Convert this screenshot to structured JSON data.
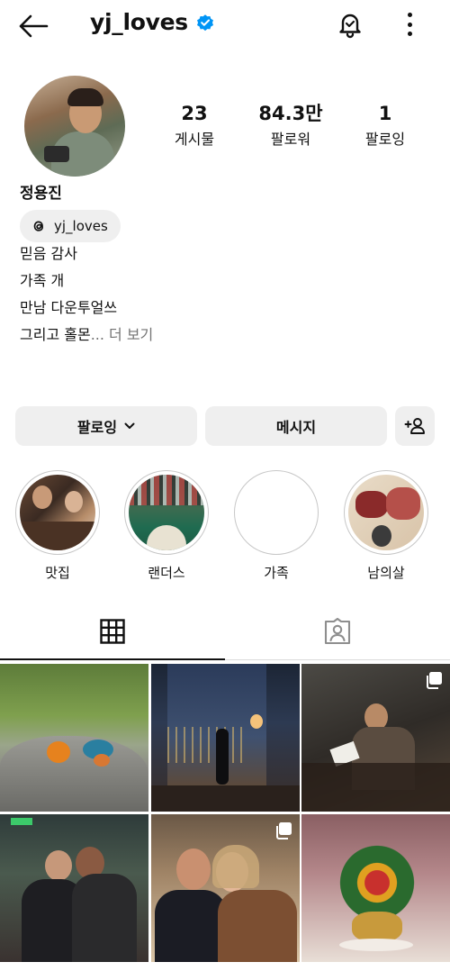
{
  "header": {
    "username": "yj_loves"
  },
  "profile": {
    "stats": [
      {
        "value": "23",
        "label": "게시물"
      },
      {
        "value": "84.3만",
        "label": "팔로워"
      },
      {
        "value": "1",
        "label": "팔로잉"
      }
    ],
    "name": "정용진",
    "threads_handle": "yj_loves",
    "bio_lines": [
      "믿음 감사",
      "가족 개",
      "만남 다운투얼쓰",
      "그리고 홀몬"
    ],
    "bio_more": "... 더 보기"
  },
  "actions": {
    "following_label": "팔로잉",
    "message_label": "메시지"
  },
  "highlights": [
    {
      "label": "맛집"
    },
    {
      "label": "랜더스"
    },
    {
      "label": "가족"
    },
    {
      "label": "남의살"
    }
  ],
  "tabs": [
    {
      "icon": "grid-icon"
    },
    {
      "icon": "tagged-icon"
    }
  ],
  "colors": {
    "verified": "#0095f6",
    "button_bg": "#efefef",
    "muted_text": "#737373"
  }
}
